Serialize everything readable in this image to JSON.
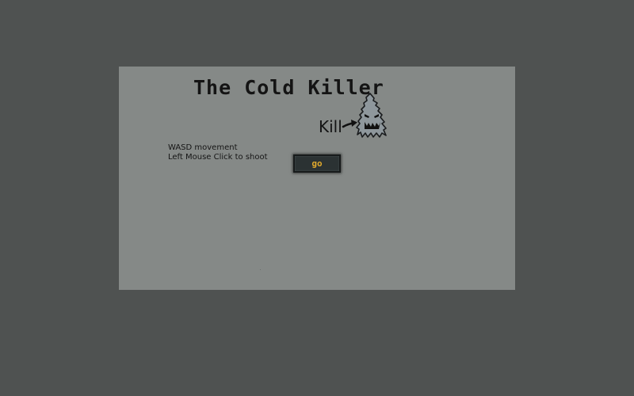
{
  "game": {
    "title": "The Cold Killer",
    "kill_label": "Kill",
    "enemy_icon": "ghost-tree-enemy-icon",
    "instructions": {
      "line1": "WASD movement",
      "line2": "Left Mouse Click to shoot"
    },
    "start_button_label": "go"
  },
  "colors": {
    "page_background": "#4f5251",
    "canvas_background": "#858987",
    "text": "#141414",
    "button_background": "#2b3233",
    "button_text": "#e0a92d",
    "enemy_fill": "#8e979c"
  }
}
